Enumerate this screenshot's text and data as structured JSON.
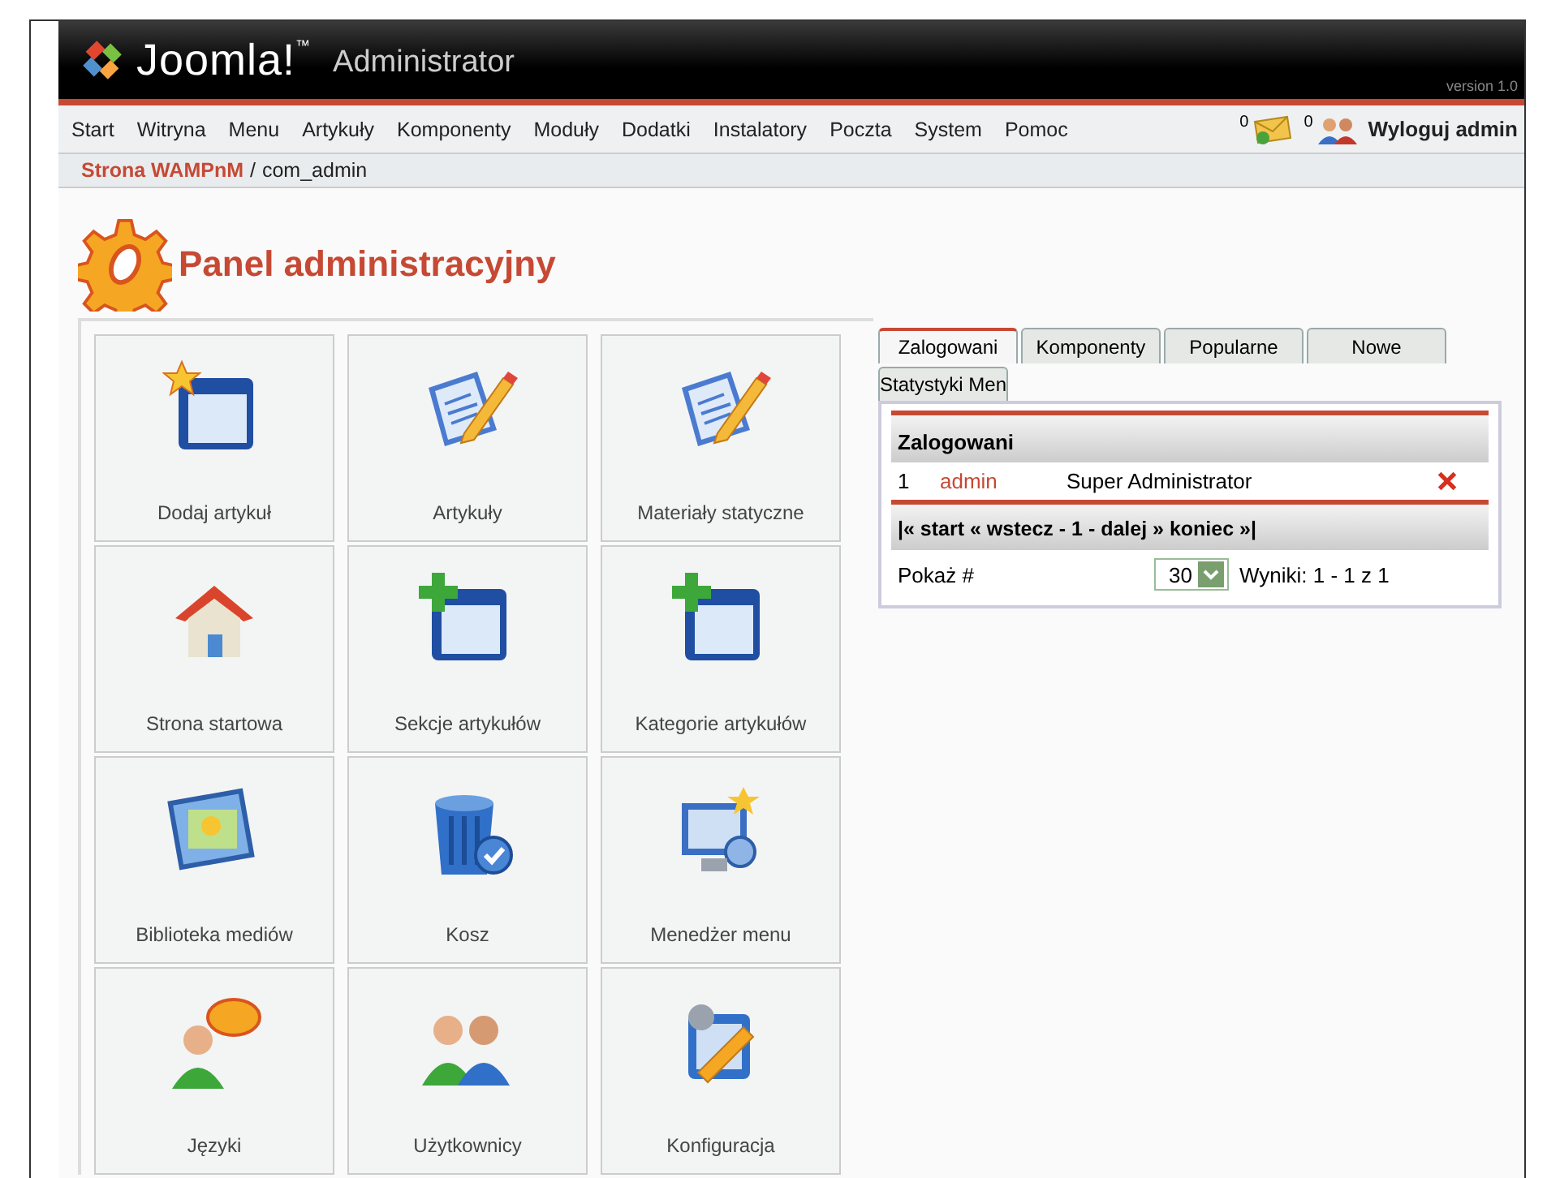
{
  "header": {
    "logo": "Joomla!",
    "trademark": "™",
    "product": "Administrator",
    "version": "version 1.0"
  },
  "menu": {
    "items": [
      "Start",
      "Witryna",
      "Menu",
      "Artykuły",
      "Komponenty",
      "Moduły",
      "Dodatki",
      "Instalatory",
      "Poczta",
      "System",
      "Pomoc"
    ],
    "messages_count": "0",
    "users_count": "0",
    "logout": "Wyloguj admin"
  },
  "breadcrumb": {
    "site": "Strona WAMPnM",
    "separator": "/",
    "current": "com_admin"
  },
  "page_title": "Panel administracyjny",
  "tiles": [
    {
      "label": "Dodaj artykuł",
      "kind": "window-star"
    },
    {
      "label": "Artykuły",
      "kind": "document-pencil"
    },
    {
      "label": "Materiały statyczne",
      "kind": "document-pencil"
    },
    {
      "label": "Strona startowa",
      "kind": "house"
    },
    {
      "label": "Sekcje artykułów",
      "kind": "window-plus"
    },
    {
      "label": "Kategorie artykułów",
      "kind": "window-plus"
    },
    {
      "label": "Biblioteka mediów",
      "kind": "picture-frame"
    },
    {
      "label": "Kosz",
      "kind": "trash"
    },
    {
      "label": "Menedżer menu",
      "kind": "menu-stars"
    },
    {
      "label": "Języki",
      "kind": "speech-person"
    },
    {
      "label": "Użytkownicy",
      "kind": "people"
    },
    {
      "label": "Konfiguracja",
      "kind": "tools"
    }
  ],
  "tabs": [
    {
      "label": "Zalogowani",
      "selected": true
    },
    {
      "label": "Komponenty",
      "selected": false
    },
    {
      "label": "Popularne",
      "selected": false
    },
    {
      "label": "Nowe",
      "selected": false
    },
    {
      "label": "Statystyki Men",
      "selected": false
    }
  ],
  "logged_table": {
    "title": "Zalogowani",
    "rows": [
      {
        "number": "1",
        "user": "admin",
        "group": "Super Administrator"
      }
    ],
    "pagination": "|« start « wstecz - 1 - dalej » koniec »|",
    "show_label": "Pokaż #",
    "page_size": "30",
    "results": "Wyniki: 1 - 1 z 1"
  }
}
